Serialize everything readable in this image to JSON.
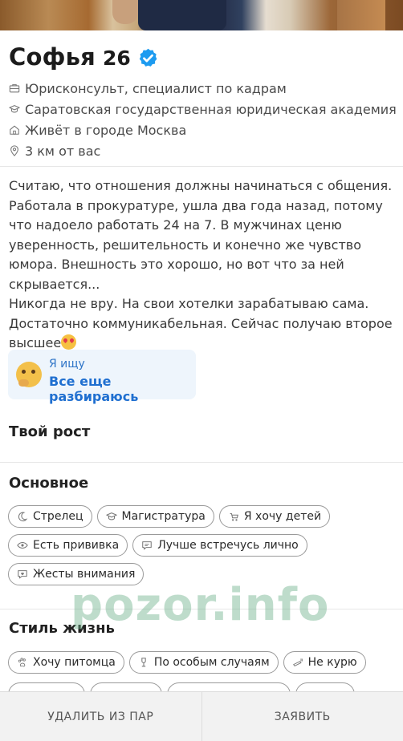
{
  "profile": {
    "name": "Софья",
    "age": "26",
    "info": [
      {
        "icon": "briefcase-icon",
        "text": "Юрисконсульт, специалист по кадрам"
      },
      {
        "icon": "graduation-cap-icon",
        "text": "Саратовская государственная юридическая академия"
      },
      {
        "icon": "house-icon",
        "text": "Живёт в городе Москва"
      },
      {
        "icon": "location-pin-icon",
        "text": "3 км от вас"
      }
    ],
    "bio": "Считаю, что отношения должны начинаться с общения. Работала в прокуратуре, ушла два года назад, потому что надоело работать 24 на 7. В мужчинах ценю уверенность, решительность и конечно же чувство юмора. Внешность это хорошо, но вот что за ней скрывается...\nНикогда не вру. На свои хотелки зарабатываю сама. Достаточно коммуникабельная. Сейчас получаю второе высшее"
  },
  "seeking": {
    "label": "Я ищу",
    "value": "Все еще разбираюсь"
  },
  "height_section": {
    "title": "Твой рост"
  },
  "basics": {
    "title": "Основное",
    "chips": [
      {
        "icon": "moon-icon",
        "label": "Стрелец"
      },
      {
        "icon": "graduation-cap-icon",
        "label": "Магистратура"
      },
      {
        "icon": "stroller-icon",
        "label": "Я хочу детей"
      },
      {
        "icon": "eye-icon",
        "label": "Есть прививка"
      },
      {
        "icon": "chat-bubble-icon",
        "label": "Лучше встречусь лично"
      },
      {
        "icon": "chat-heart-icon",
        "label": "Жесты внимания"
      }
    ]
  },
  "lifestyle": {
    "title": "Стиль жизнь",
    "chips": [
      {
        "icon": "paw-icon",
        "label": "Хочу питомца"
      },
      {
        "icon": "wine-glass-icon",
        "label": "По особым случаям"
      },
      {
        "icon": "no-smoking-icon",
        "label": "Не курю"
      }
    ]
  },
  "watermark": "pozor.info",
  "actions": {
    "remove": "УДАЛИТЬ ИЗ ПАР",
    "report": "ЗАЯВИТЬ"
  },
  "colors": {
    "verified": "#1d9bf0",
    "seek_bg": "#eef5fc",
    "seek_text": "#1f6fd0"
  }
}
